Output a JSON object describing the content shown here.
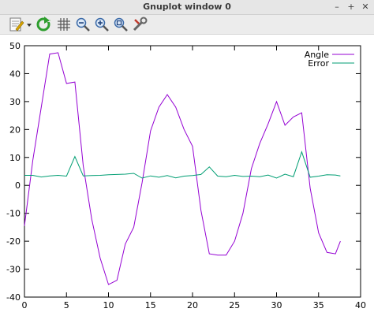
{
  "window": {
    "title": "Gnuplot window 0",
    "minimize_glyph": "–",
    "maximize_glyph": "+",
    "close_glyph": "✕"
  },
  "toolbar": {
    "icons": [
      "export-icon",
      "replot-icon",
      "grid-icon",
      "zoom-out-icon",
      "zoom-in-icon",
      "zoom-fit-icon",
      "settings-icon"
    ]
  },
  "chart_data": {
    "type": "line",
    "title": "",
    "xlabel": "",
    "ylabel": "",
    "xlim": [
      0,
      40
    ],
    "ylim": [
      -40,
      50
    ],
    "xticks": [
      0,
      5,
      10,
      15,
      20,
      25,
      30,
      35,
      40
    ],
    "yticks": [
      -40,
      -30,
      -20,
      -10,
      0,
      10,
      20,
      30,
      40,
      50
    ],
    "grid": false,
    "legend_position": "top-right",
    "series": [
      {
        "name": "Angle",
        "color": "#9400d3",
        "x": [
          0,
          1,
          2,
          3,
          4,
          5,
          6,
          7,
          8,
          9,
          10,
          11,
          12,
          13,
          14,
          15,
          16,
          17,
          18,
          19,
          20,
          21,
          22,
          23,
          24,
          25,
          26,
          27,
          28,
          29,
          30,
          31,
          32,
          33,
          34,
          35,
          36,
          37,
          37.6
        ],
        "y": [
          -14.5,
          9,
          28,
          47,
          47.5,
          36.5,
          37,
          7,
          -12,
          -26,
          -35.5,
          -34,
          -21,
          -15,
          1,
          19.5,
          28,
          32.5,
          28,
          20,
          14,
          -9,
          -24.5,
          -25,
          -25,
          -20,
          -10,
          6,
          15,
          22,
          30,
          21.5,
          24.5,
          26,
          -1,
          -17,
          -24,
          -24.5,
          -20
        ]
      },
      {
        "name": "Error",
        "color": "#009e73",
        "x": [
          0,
          1,
          2,
          3,
          4,
          5,
          6,
          7,
          8,
          9,
          10,
          11,
          12,
          13,
          14,
          15,
          16,
          17,
          18,
          19,
          20,
          21,
          22,
          23,
          24,
          25,
          26,
          27,
          28,
          29,
          30,
          31,
          32,
          33,
          34,
          35,
          36,
          37,
          37.6
        ],
        "y": [
          3.6,
          3.6,
          3,
          3.4,
          3.6,
          3.3,
          10.3,
          3.4,
          3.5,
          3.6,
          3.8,
          3.9,
          4,
          4.3,
          2.6,
          3.4,
          2.9,
          3.5,
          2.7,
          3.3,
          3.5,
          3.9,
          6.6,
          3.3,
          3.1,
          3.6,
          3.2,
          3.3,
          3.1,
          3.7,
          2.6,
          4,
          3.1,
          12,
          2.9,
          3.3,
          3.8,
          3.7,
          3.4
        ]
      }
    ]
  }
}
